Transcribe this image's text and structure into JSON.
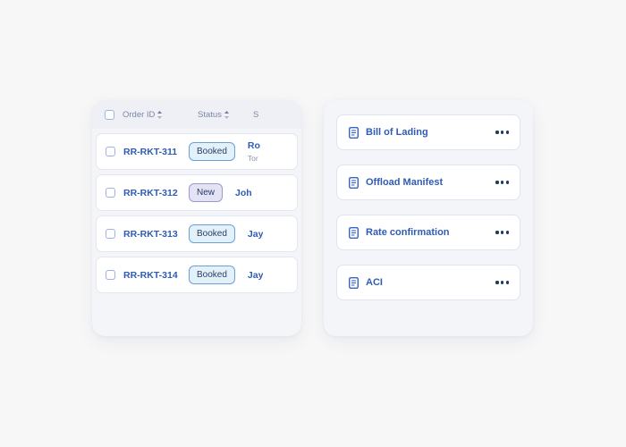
{
  "orders_panel": {
    "columns": [
      {
        "label": "Order ID",
        "sort_icon": "sort-arrows-icon"
      },
      {
        "label": "Status",
        "sort_icon": "sort-arrows-icon"
      },
      {
        "label": "S",
        "sort_icon": ""
      }
    ],
    "rows": [
      {
        "order_id": "RR-RKT-311",
        "status": "Booked",
        "status_variant": "booked",
        "shipper_main": "Ro",
        "shipper_sub": "Tor"
      },
      {
        "order_id": "RR-RKT-312",
        "status": "New",
        "status_variant": "new",
        "shipper_main": "Joh",
        "shipper_sub": ""
      },
      {
        "order_id": "RR-RKT-313",
        "status": "Booked",
        "status_variant": "booked",
        "shipper_main": "Jay",
        "shipper_sub": ""
      },
      {
        "order_id": "RR-RKT-314",
        "status": "Booked",
        "status_variant": "booked",
        "shipper_main": "Jay",
        "shipper_sub": ""
      }
    ]
  },
  "documents_panel": {
    "items": [
      {
        "label": "Bill of Lading",
        "icon": "document-icon",
        "menu_icon": "more-options-icon"
      },
      {
        "label": "Offload Manifest",
        "icon": "document-icon",
        "menu_icon": "more-options-icon"
      },
      {
        "label": "Rate confirmation",
        "icon": "document-icon",
        "menu_icon": "more-options-icon"
      },
      {
        "label": "ACI",
        "icon": "document-icon",
        "menu_icon": "more-options-icon"
      }
    ]
  },
  "colors": {
    "page_background": "#f7f7f8",
    "panel_background": "#f4f5f9",
    "accent_blue": "#2f5bb7",
    "badge_booked_bg": "#e3f1fb",
    "badge_booked_border": "#6a9fd8",
    "badge_new_bg": "#e4e3f6",
    "badge_new_border": "#9a9ad0",
    "header_text": "#7b87a8",
    "muted_text": "#8b93aa"
  }
}
